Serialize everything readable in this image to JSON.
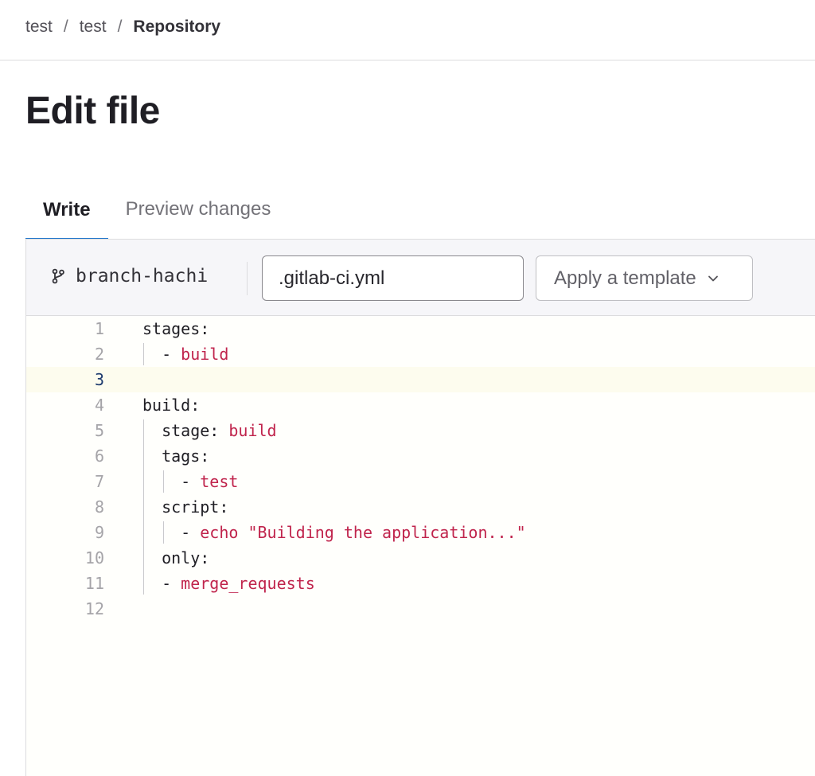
{
  "breadcrumb": {
    "items": [
      "test",
      "test"
    ],
    "current": "Repository",
    "separator": "/"
  },
  "title": "Edit file",
  "tabs": [
    {
      "label": "Write",
      "active": true
    },
    {
      "label": "Preview changes",
      "active": false
    }
  ],
  "toolbar": {
    "branch_icon": "branch-icon",
    "branch_name": "branch-hachi",
    "filename": ".gitlab-ci.yml",
    "template_button": "Apply a template",
    "template_chevron": "chevron-down-icon"
  },
  "editor": {
    "current_line": 3,
    "lines": [
      {
        "num": "1",
        "key": "stages:",
        "val": ""
      },
      {
        "num": "2",
        "key": "  - ",
        "val": "build"
      },
      {
        "num": "3",
        "key": "",
        "val": ""
      },
      {
        "num": "4",
        "key": "build:",
        "val": ""
      },
      {
        "num": "5",
        "key": "  stage: ",
        "val": "build"
      },
      {
        "num": "6",
        "key": "  tags:",
        "val": ""
      },
      {
        "num": "7",
        "key": "    - ",
        "val": "test"
      },
      {
        "num": "8",
        "key": "  script:",
        "val": ""
      },
      {
        "num": "9",
        "key": "    - ",
        "val": "echo \"Building the application...\""
      },
      {
        "num": "10",
        "key": "  only:",
        "val": ""
      },
      {
        "num": "11",
        "key": "  - ",
        "val": "merge_requests"
      },
      {
        "num": "12",
        "key": "",
        "val": ""
      }
    ]
  },
  "colors": {
    "accent_tab": "#1f75cb",
    "string": "#c0244c",
    "current_line_bg": "#fdfcee"
  }
}
